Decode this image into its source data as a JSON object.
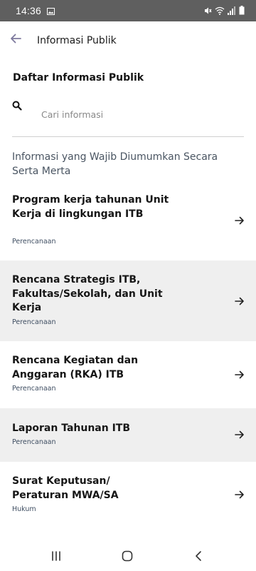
{
  "status_bar": {
    "time": "14:36"
  },
  "header": {
    "title": "Informasi Publik"
  },
  "page": {
    "section_title": "Daftar Informasi Publik"
  },
  "search": {
    "placeholder": "Cari informasi",
    "value": ""
  },
  "category_heading": "Informasi yang Wajib Diumumkan Secara Serta Merta",
  "items": [
    {
      "title": "Program kerja tahunan Unit Kerja di lingkungan ITB",
      "category": "Perencanaan"
    },
    {
      "title": "Rencana Strategis ITB, Fakultas/Sekolah, dan Unit Kerja",
      "category": "Perencanaan"
    },
    {
      "title": "Rencana Kegiatan dan Anggaran (RKA) ITB",
      "category": "Perencanaan"
    },
    {
      "title": "Laporan Tahunan ITB",
      "category": "Perencanaan"
    },
    {
      "title": "Surat Keputusan/ Peraturan MWA/SA",
      "category": "Hukum"
    }
  ],
  "colors": {
    "status_bar": "#5f5f5f",
    "category_text": "#3f4e62",
    "shaded_row": "#efefef",
    "back_arrow": "#7e7a9e"
  },
  "icons": {
    "back": "arrow-left-icon",
    "search": "search-icon",
    "item_arrow": "arrow-right-icon"
  }
}
